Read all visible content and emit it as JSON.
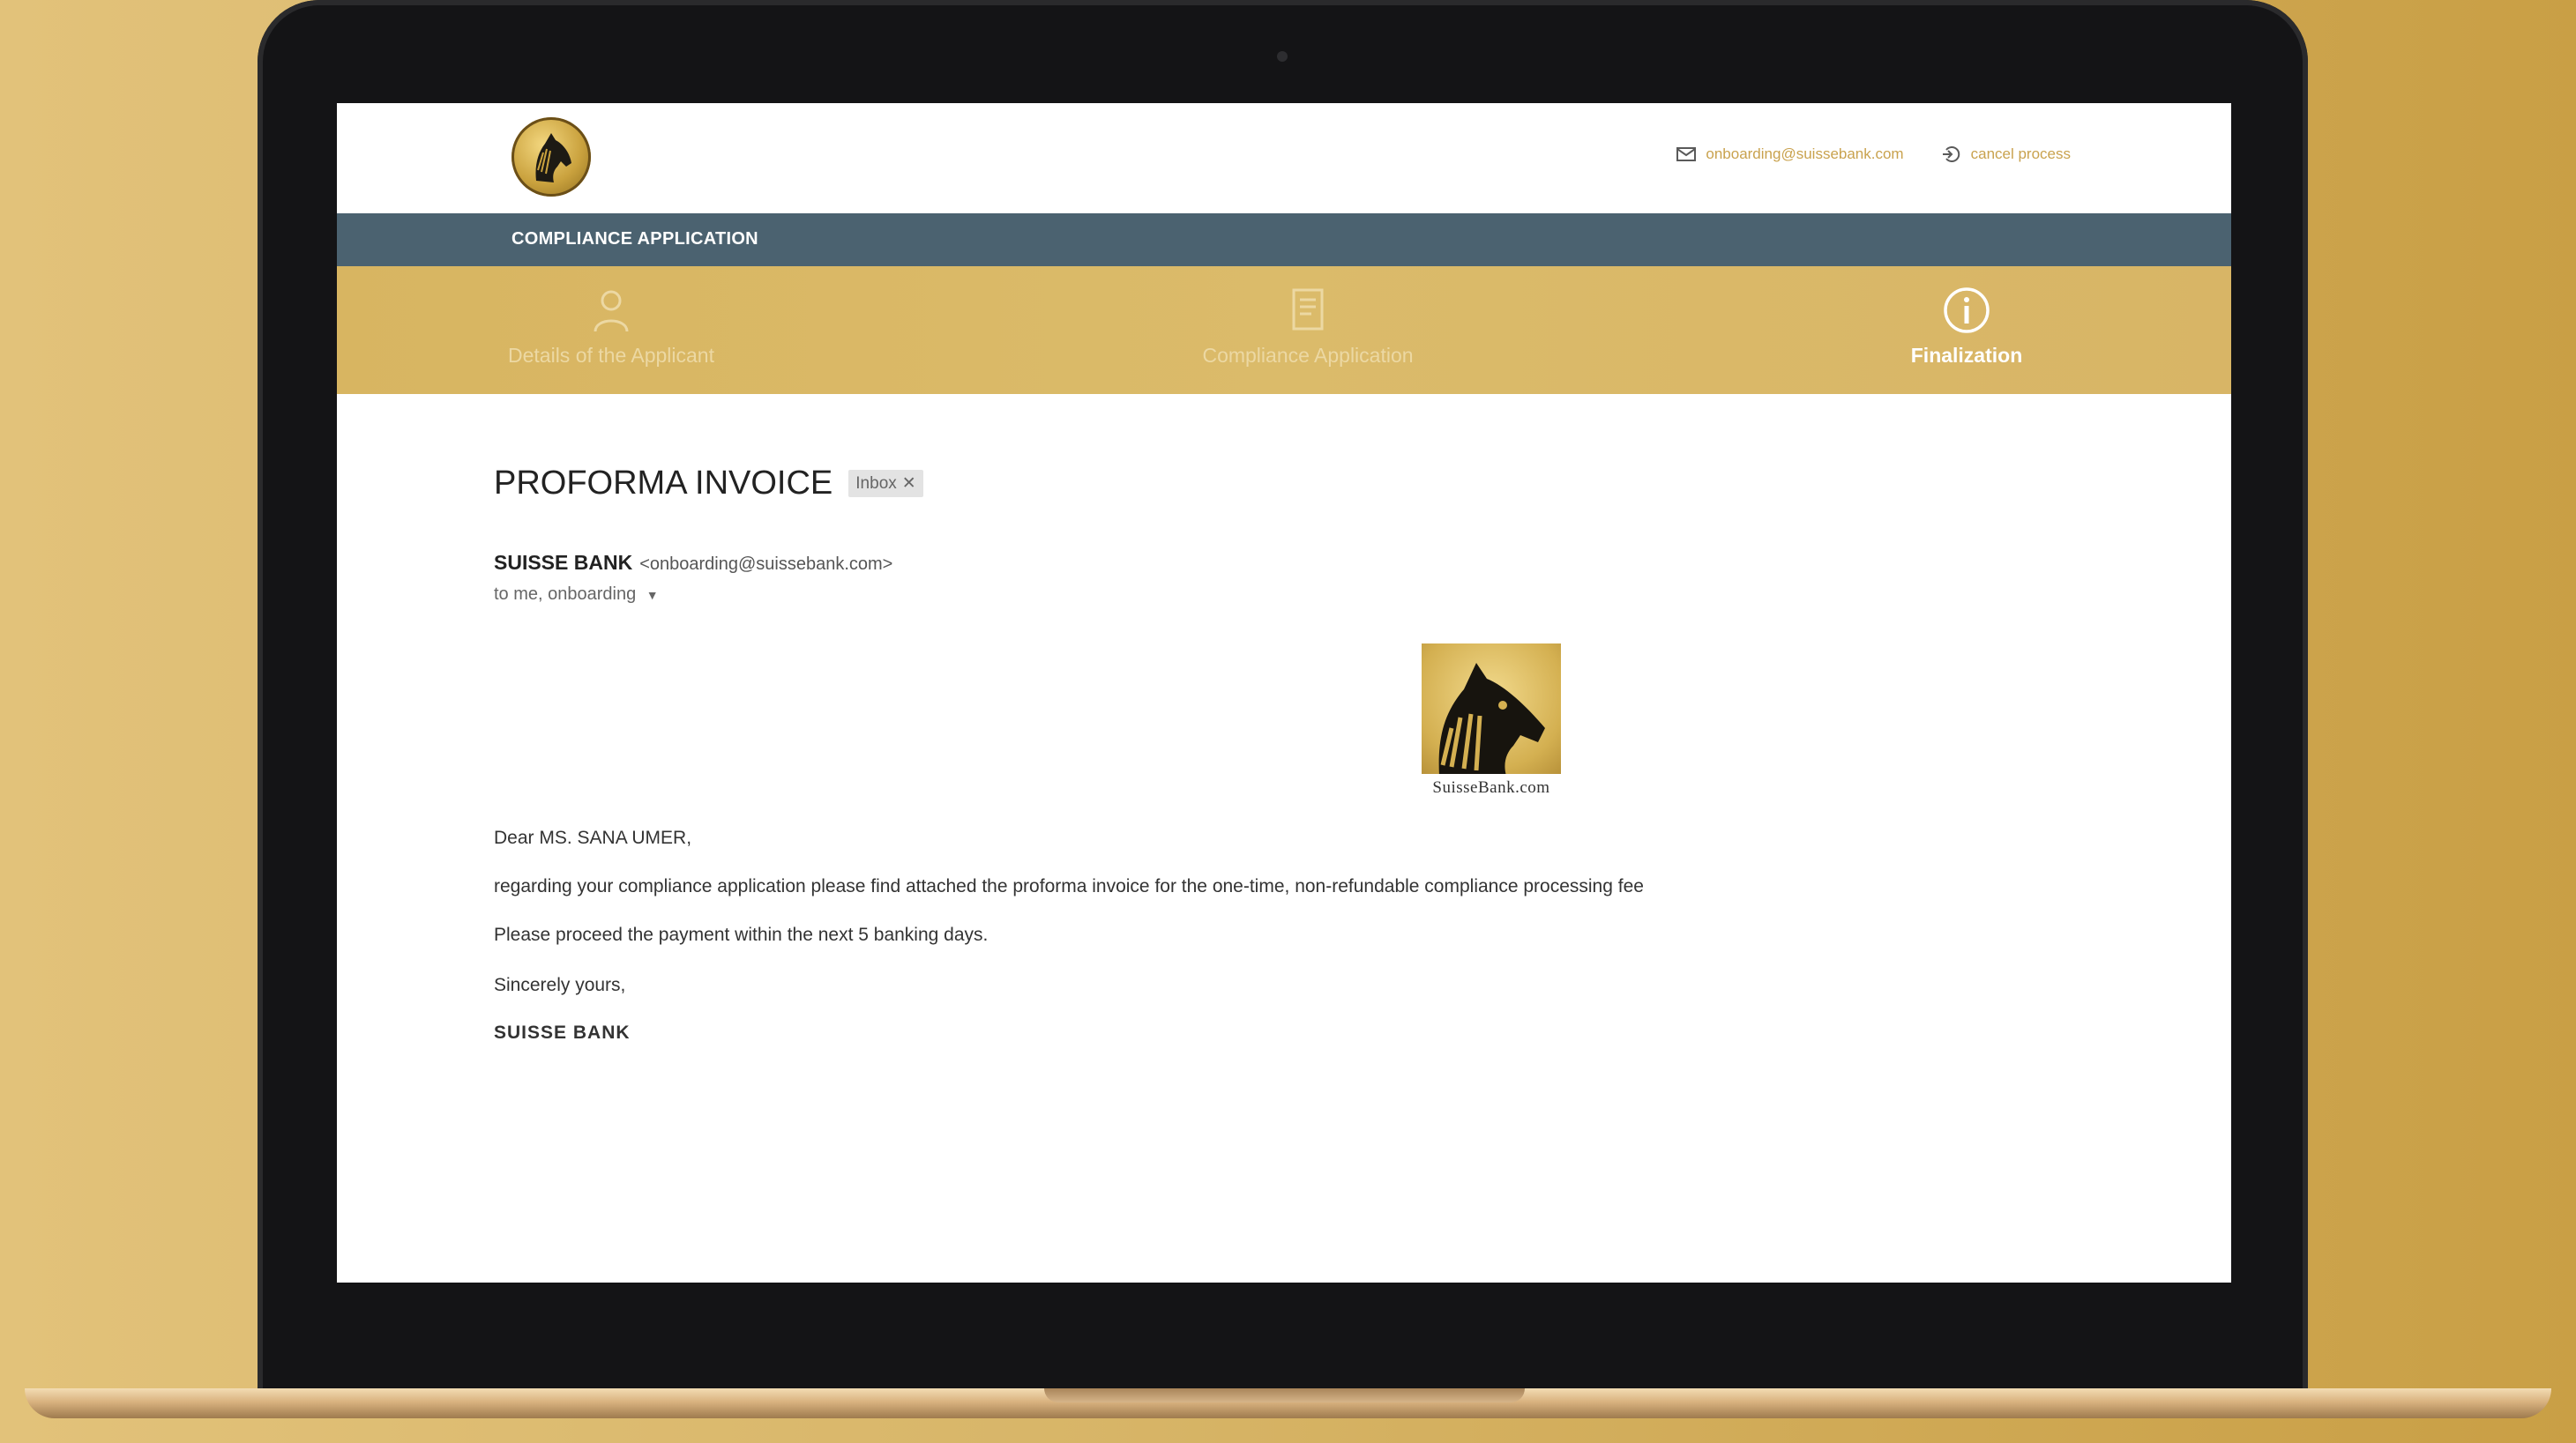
{
  "header": {
    "email_link": "onboarding@suissebank.com",
    "cancel_link": "cancel process"
  },
  "band": {
    "title": "COMPLIANCE APPLICATION"
  },
  "steps": [
    {
      "label": "Details of the Applicant",
      "icon": "person-icon"
    },
    {
      "label": "Compliance Application",
      "icon": "document-icon"
    },
    {
      "label": "Finalization",
      "icon": "info-icon",
      "active": true
    }
  ],
  "email": {
    "subject": "PROFORMA INVOICE",
    "badge": "Inbox",
    "sender_name": "SUISSE BANK",
    "sender_email": "<onboarding@suissebank.com>",
    "recipients": "to me, onboarding",
    "logo_text": "SuisseBank.com",
    "greeting": "Dear MS. SANA UMER,",
    "line1": "regarding your compliance application please find attached the proforma invoice for the one-time, non-refundable compliance processing fee",
    "line2": "Please proceed the payment within the next 5 banking days.",
    "closing": "Sincerely yours,",
    "signature": "SUISSE BANK"
  },
  "colors": {
    "gold": "#d8b561",
    "band": "#4b6270",
    "link": "#c9a24e"
  }
}
